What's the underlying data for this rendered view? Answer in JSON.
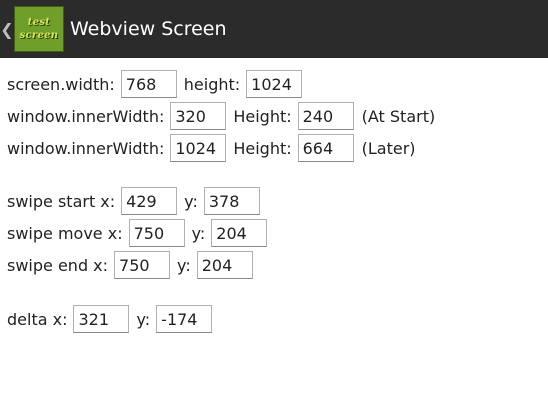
{
  "actionbar": {
    "back_glyph": "❮",
    "icon_text_top": "test",
    "icon_text_bottom": "screen",
    "title": "Webview Screen"
  },
  "screen": {
    "width_label": "screen.width:",
    "width_value": "768",
    "height_label": "height:",
    "height_value": "1024"
  },
  "window_start": {
    "width_label": "window.innerWidth:",
    "width_value": "320",
    "height_label": "Height:",
    "height_value": "240",
    "note": "(At Start)"
  },
  "window_later": {
    "width_label": "window.innerWidth:",
    "width_value": "1024",
    "height_label": "Height:",
    "height_value": "664",
    "note": "(Later)"
  },
  "swipe_start": {
    "x_label": "swipe start x:",
    "x_value": "429",
    "y_label": "y:",
    "y_value": "378"
  },
  "swipe_move": {
    "x_label": "swipe move x:",
    "x_value": "750",
    "y_label": "y:",
    "y_value": "204"
  },
  "swipe_end": {
    "x_label": "swipe end x:",
    "x_value": "750",
    "y_label": "y:",
    "y_value": "204"
  },
  "delta": {
    "x_label": "delta x:",
    "x_value": "321",
    "y_label": "y:",
    "y_value": "-174"
  }
}
